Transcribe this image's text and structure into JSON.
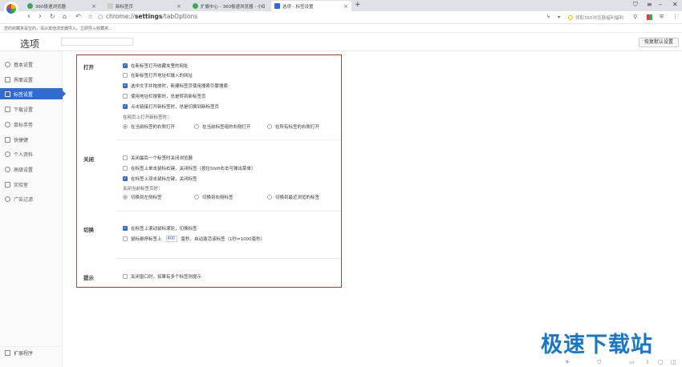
{
  "tabs": [
    {
      "label": "360极速浏览器",
      "color": "#3aa757"
    },
    {
      "label": "新标签页",
      "color": "#bbbbbb"
    },
    {
      "label": "扩展中心 - 360极速浏览器 - 小工具",
      "color": "#3aa757"
    },
    {
      "label": "选项 - 标签设置",
      "color": "#2e6cd1"
    }
  ],
  "tab_close": "×",
  "new_tab": "+",
  "address": {
    "prefix": "chrome://",
    "bold": "settings",
    "suffix": "/tabOptions"
  },
  "right_search": "领取360浏览器福利福利",
  "bookmark_notice": "您的收藏夹是空的，请从其他浏览器导入。立即导入收藏夹...",
  "page_title": "选项",
  "reset_label": "恢复默认设置",
  "sidebar": [
    {
      "label": "基本设置"
    },
    {
      "label": "界面设置"
    },
    {
      "label": "标签设置"
    },
    {
      "label": "下载设置"
    },
    {
      "label": "鼠标手势"
    },
    {
      "label": "快捷键"
    },
    {
      "label": "个人资料"
    },
    {
      "label": "高级设置"
    },
    {
      "label": "实验室"
    },
    {
      "label": "广告过滤"
    }
  ],
  "sidebar_active": 2,
  "extensions_label": "扩展程序",
  "sections": {
    "open": {
      "label": "打开",
      "checks": [
        {
          "label": "在新标签打开收藏夹里的网址",
          "checked": true
        },
        {
          "label": "在新标签打开地址栏输入的网址",
          "checked": false
        },
        {
          "label": "选中文字并拖放时，新建标签页使用搜索引擎搜索",
          "checked": true
        },
        {
          "label": "使用地址栏搜索时，总是转到新标签页",
          "checked": false
        },
        {
          "label": "点击链接打开新标签时，总是切换到新标签页",
          "checked": true
        }
      ],
      "radio_title": "在网页上打开新标签时：",
      "radios": [
        {
          "label": "在当前标签的右侧打开",
          "on": true
        },
        {
          "label": "在当前标签组的右侧打开",
          "on": false
        },
        {
          "label": "在所有标签的右侧打开",
          "on": false
        }
      ]
    },
    "close": {
      "label": "关闭",
      "checks": [
        {
          "label": "关闭最后一个标签时关闭浏览器",
          "checked": false
        },
        {
          "label": "在标签上单击鼠标右键，关闭标签（按住Shift右击可弹出菜单）",
          "checked": false
        },
        {
          "label": "在标签上双击鼠标左键，关闭标签",
          "checked": true
        }
      ],
      "radio_title": "关闭当前标签页时：",
      "radios": [
        {
          "label": "切换到左侧标签",
          "on": true
        },
        {
          "label": "切换到右侧标签",
          "on": false
        },
        {
          "label": "切换到最近浏览的标签",
          "on": false
        }
      ]
    },
    "switch": {
      "label": "切换",
      "checks": [
        {
          "label": "在标签上滚动鼠标滚轮，切换标签",
          "checked": true
        }
      ],
      "hover_prefix": "鼠标悬停标签上",
      "hover_value": "400",
      "hover_suffix": "毫秒，自动激活该标签（1秒=1000毫秒）",
      "hover_checked": false
    },
    "hint": {
      "label": "提示",
      "checks": [
        {
          "label": "关闭窗口时，如果有多个标签则提示",
          "checked": false
        }
      ]
    }
  },
  "watermark": "极速下载站"
}
